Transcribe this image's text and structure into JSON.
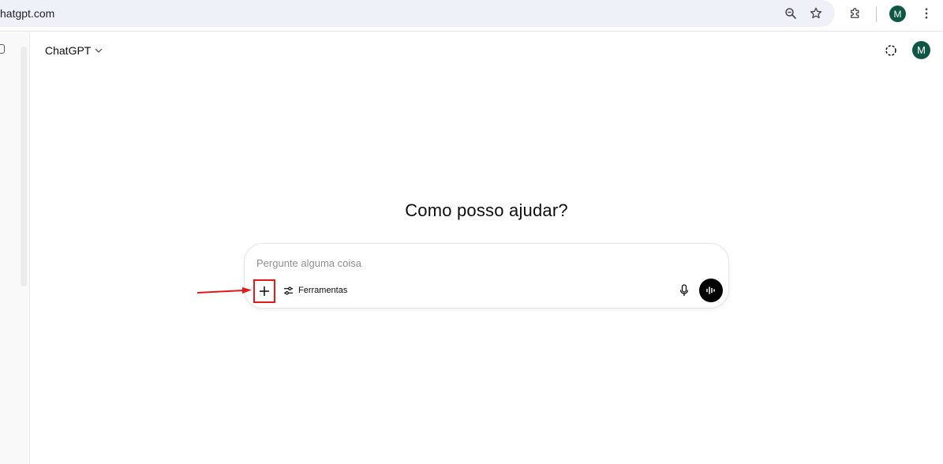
{
  "browser": {
    "url": "hatgpt.com",
    "profile_initial": "M",
    "icons": [
      "zoom-icon",
      "star-icon",
      "extensions-icon",
      "more-vert-icon"
    ]
  },
  "header": {
    "model_label": "ChatGPT",
    "avatar_initial": "M"
  },
  "main": {
    "greeting": "Como posso ajudar?",
    "composer": {
      "placeholder": "Pergunte alguma coisa",
      "value": "",
      "tools_label": "Ferramentas"
    }
  },
  "annotation": {
    "highlight_color": "#e61919"
  },
  "colors": {
    "avatar": "#0f5745",
    "voice_button": "#000000",
    "omnibox": "#eef1f8"
  }
}
